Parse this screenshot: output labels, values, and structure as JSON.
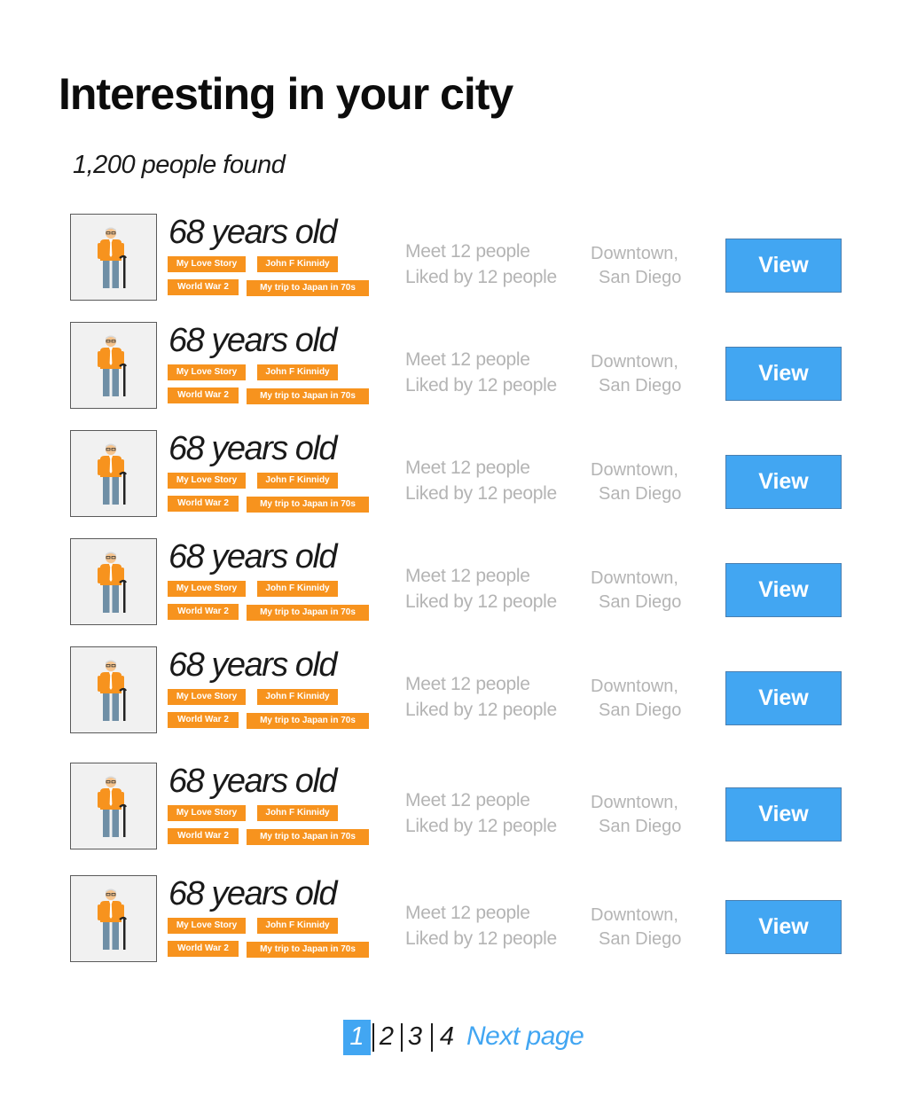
{
  "header": {
    "title": "Interesting in your city",
    "result_count": "1,200 people found"
  },
  "people": [
    {
      "age": "68 years old",
      "tags": [
        "My Love Story",
        "John F Kinnidy",
        "World War 2",
        "My trip to Japan in 70s"
      ],
      "meet": "Meet 12 people",
      "liked": "Liked by 12 people",
      "location_line1": "Downtown,",
      "location_line2": "San Diego",
      "button": "View"
    },
    {
      "age": "68 years old",
      "tags": [
        "My Love Story",
        "John F Kinnidy",
        "World War 2",
        "My trip to Japan in 70s"
      ],
      "meet": "Meet 12 people",
      "liked": "Liked by 12 people",
      "location_line1": "Downtown,",
      "location_line2": "San Diego",
      "button": "View"
    },
    {
      "age": "68 years old",
      "tags": [
        "My Love Story",
        "John F Kinnidy",
        "World War 2",
        "My trip to Japan in 70s"
      ],
      "meet": "Meet 12 people",
      "liked": "Liked by 12 people",
      "location_line1": "Downtown,",
      "location_line2": "San Diego",
      "button": "View"
    },
    {
      "age": "68 years old",
      "tags": [
        "My Love Story",
        "John F Kinnidy",
        "World War 2",
        "My trip to Japan in 70s"
      ],
      "meet": "Meet 12 people",
      "liked": "Liked by 12 people",
      "location_line1": "Downtown,",
      "location_line2": "San Diego",
      "button": "View"
    },
    {
      "age": "68 years old",
      "tags": [
        "My Love Story",
        "John F Kinnidy",
        "World War 2",
        "My trip to Japan in 70s"
      ],
      "meet": "Meet 12 people",
      "liked": "Liked by 12 people",
      "location_line1": "Downtown,",
      "location_line2": "San Diego",
      "button": "View"
    },
    {
      "age": "68 years old",
      "tags": [
        "My Love Story",
        "John F Kinnidy",
        "World War 2",
        "My trip to Japan in 70s"
      ],
      "meet": "Meet 12 people",
      "liked": "Liked by 12 people",
      "location_line1": "Downtown,",
      "location_line2": "San Diego",
      "button": "View"
    },
    {
      "age": "68 years old",
      "tags": [
        "My Love Story",
        "John F Kinnidy",
        "World War 2",
        "My trip to Japan in 70s"
      ],
      "meet": "Meet 12 people",
      "liked": "Liked by 12 people",
      "location_line1": "Downtown,",
      "location_line2": "San Diego",
      "button": "View"
    }
  ],
  "pagination": {
    "pages": [
      "1",
      "2",
      "3",
      "4"
    ],
    "current": "1",
    "next_label": "Next page"
  },
  "colors": {
    "accent": "#42a6f2",
    "tag": "#f7931e",
    "muted_text": "#b4b4b4"
  },
  "icons": {
    "avatar": "elderly-man-with-cane-icon"
  }
}
